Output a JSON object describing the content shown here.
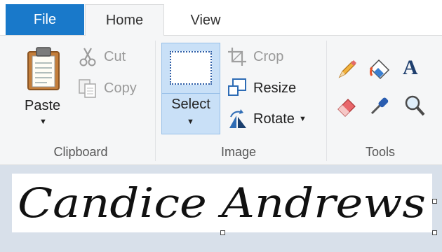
{
  "tabs": {
    "file": "File",
    "home": "Home",
    "view": "View"
  },
  "clipboard": {
    "paste": "Paste",
    "cut": "Cut",
    "copy": "Copy",
    "group_label": "Clipboard"
  },
  "image": {
    "select": "Select",
    "crop": "Crop",
    "resize": "Resize",
    "rotate": "Rotate",
    "group_label": "Image"
  },
  "tools": {
    "group_label": "Tools",
    "items": [
      "pencil-icon",
      "fill-bucket-icon",
      "text-icon",
      "eraser-icon",
      "color-picker-icon",
      "magnifier-icon"
    ]
  },
  "canvas": {
    "signature_text": "Candice Andrews"
  },
  "colors": {
    "file_tab": "#1979ca",
    "ribbon_bg": "#f5f6f7",
    "select_bg": "#c9e0f7",
    "canvas_bg": "#d8e0ea"
  }
}
